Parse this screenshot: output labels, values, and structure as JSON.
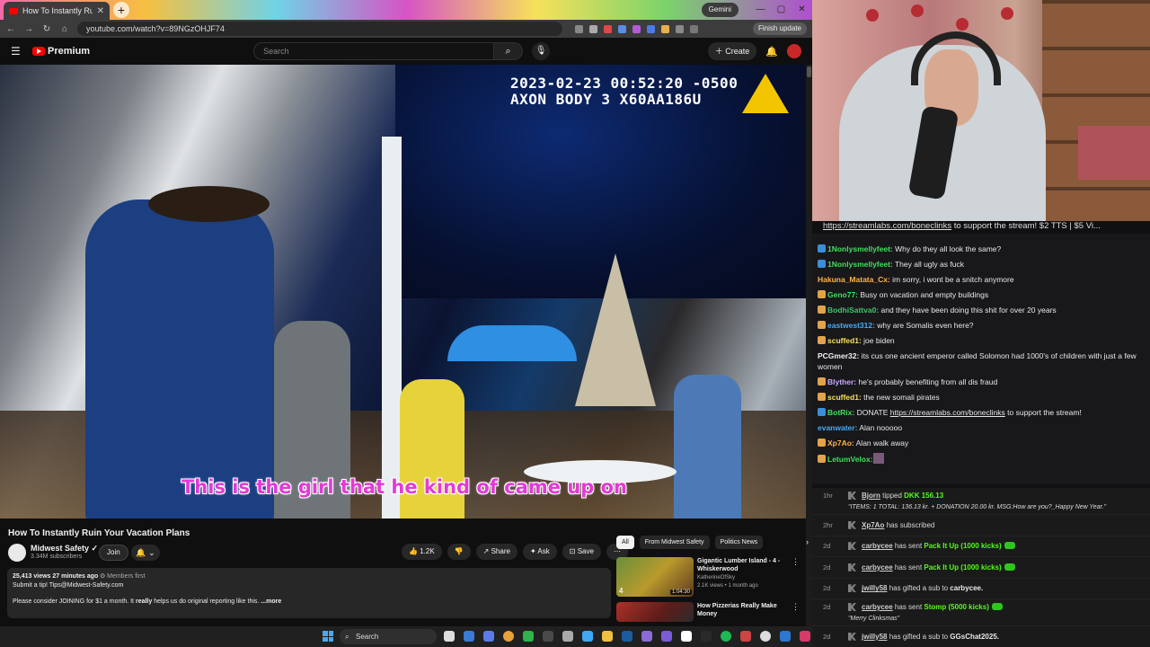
{
  "browser": {
    "tab_title": "How To Instantly Ruin Your",
    "gemini_label": "Gemini",
    "url": "youtube.com/watch?v=89NGzOHJF74",
    "finish_update_label": "Finish update"
  },
  "youtube": {
    "logo_label": "Premium",
    "search_placeholder": "Search",
    "create_label": "Create"
  },
  "video": {
    "bodycam_line1": "2023-02-23 00:52:20 -0500",
    "bodycam_line2": "AXON BODY 3 X60AA186U",
    "caption": "This is the girl that he kind of came up on",
    "title": "How To Instantly Ruin Your Vacation Plans",
    "channel_name": "Midwest Safety",
    "channel_subs": "3.34M subscribers",
    "join_label": "Join",
    "like_count": "1.2K",
    "share_label": "Share",
    "ask_label": "Ask",
    "save_label": "Save",
    "meta": "25,413 views  27 minutes ago",
    "members_first": "Members first",
    "desc_line1": "Submit a tip! Tips@Midwest-Safety.com",
    "desc_line2": "Please consider JOINING for $1 a month. It",
    "desc_line2_bold": "really",
    "desc_line2_end": "helps us do original reporting like this.",
    "more_label": "...more"
  },
  "related": {
    "chips": [
      "All",
      "From Midwest Safety",
      "Politics News"
    ],
    "items": [
      {
        "title": "Gigantic Lumber Island - 4 - Whiskerwood",
        "channel": "KatherineOfSky",
        "views": "2.1K views • 1 month ago",
        "duration": "1:04:30",
        "badge": "4"
      },
      {
        "title": "How Pizzerias Really Make Money",
        "channel": "",
        "views": "",
        "duration": "",
        "badge": ""
      }
    ]
  },
  "chat": {
    "pinned_link": "https://streamlabs.com/boneclinks",
    "pinned_text": " to support the stream! $2 TTS | $5 Vi...",
    "messages": [
      {
        "user": "1Nonlysmellyfeet:",
        "text": " Why do they all look the same?",
        "color": "#3fe05a",
        "badge": "#3b8fd8"
      },
      {
        "user": "1Nonlysmellyfeet:",
        "text": " They all ugly as fuck",
        "color": "#3fe05a",
        "badge": "#3b8fd8"
      },
      {
        "user": "Hakuna_Matata_Cx:",
        "text": " im sorry, i wont be a snitch anymore",
        "color": "#ffb34a",
        "badge": ""
      },
      {
        "user": "Geno77:",
        "text": " Busy on vacation and empty buildings",
        "color": "#3fe05a",
        "badge": "#e2a34a"
      },
      {
        "user": "BodhiSattva0:",
        "text": " and they have been doing this shit for over 20 years",
        "color": "#44c36a",
        "badge": "#e2a34a"
      },
      {
        "user": "eastwest312:",
        "text": " why are Somalis even here?",
        "color": "#4aa8f0",
        "badge": "#e2a34a"
      },
      {
        "user": "scuffed1:",
        "text": " joe biden",
        "color": "#f7e15a",
        "badge": "#e2a34a"
      },
      {
        "user": "PCGmer32:",
        "text": " its cus one ancient emperor called Solomon had 1000's of children with just a few women",
        "color": "#f1f1f1",
        "badge": ""
      },
      {
        "user": "Blyther:",
        "text": " he's probably benefiting from all dis fraud",
        "color": "#c7a7ff",
        "badge": "#e2a34a"
      },
      {
        "user": "scuffed1:",
        "text": " the new somali pirates",
        "color": "#f7e15a",
        "badge": "#e2a34a"
      },
      {
        "user": "BotRix:",
        "text": " DONATE ",
        "link": "https://streamlabs.com/boneclinks",
        "text2": " to support the stream!",
        "color": "#3fe05a",
        "badge": "#3b8fd8"
      },
      {
        "user": "evanwater:",
        "text": " Alan nooooo",
        "color": "#4aa8f0",
        "badge": ""
      },
      {
        "user": "Xp7Ao:",
        "text": " Alan walk away",
        "color": "#ffb34a",
        "badge": "#e2a34a"
      },
      {
        "user": "LetumVelox:",
        "text": "",
        "color": "#3fe05a",
        "badge": "#e2a34a"
      }
    ]
  },
  "events": [
    {
      "age": "1hr",
      "user": "Bjorn",
      "action": " tipped ",
      "extra": "DKK 156.13",
      "note": "\"ITEMS: 1 TOTAL: 136.13 kr. + DONATION 20.00 kr. MSG:How are you?_Happy New Year.\""
    },
    {
      "age": "2hr",
      "user": "Xp7Ao",
      "action": " has subscribed",
      "extra": "",
      "note": ""
    },
    {
      "age": "2d",
      "user": "carbycee",
      "action": " has sent ",
      "extra": "Pack It Up (1000 kicks)",
      "note": ""
    },
    {
      "age": "2d",
      "user": "carbycee",
      "action": " has sent ",
      "extra": "Pack It Up (1000 kicks)",
      "note": ""
    },
    {
      "age": "2d",
      "user": "jwilly58",
      "action": " has gifted a sub to ",
      "extra": "carbycee.",
      "note": ""
    },
    {
      "age": "2d",
      "user": "carbycee",
      "action": " has sent ",
      "extra": "Stomp (5000 kicks)",
      "note": "\"Merry Clinksmas\""
    },
    {
      "age": "2d",
      "user": "jwilly58",
      "action": " has gifted a sub to ",
      "extra": "GGsChat2025.",
      "note": ""
    }
  ],
  "taskbar": {
    "search_label": "Search"
  }
}
